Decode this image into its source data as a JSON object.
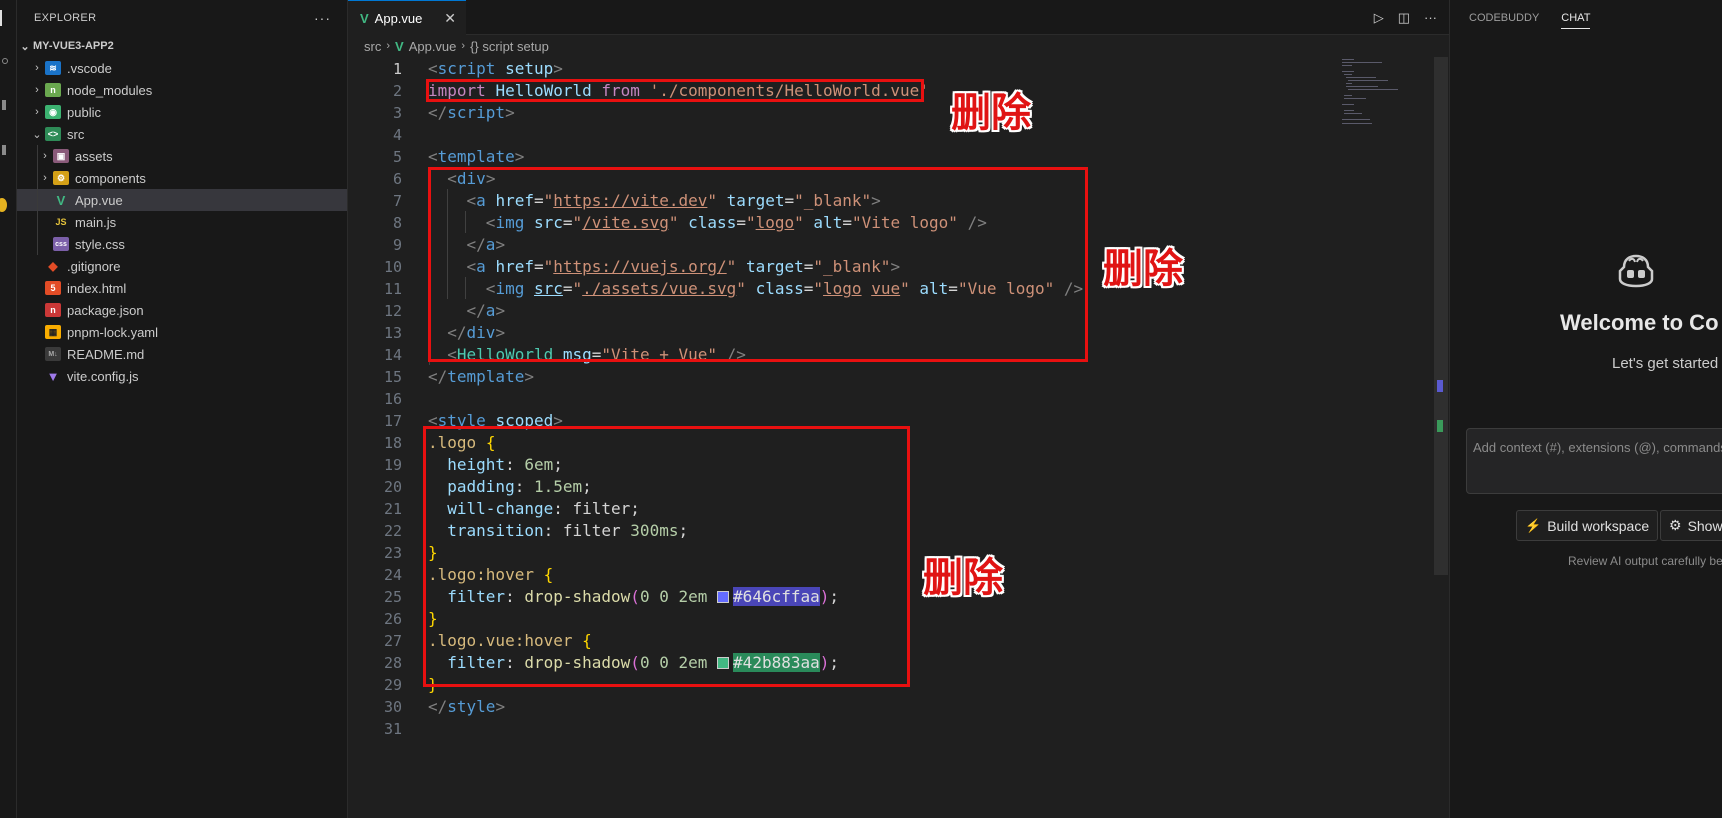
{
  "sidebar": {
    "title": "EXPLORER",
    "more": "···",
    "root": "MY-VUE3-APP2",
    "items": [
      {
        "label": ".vscode",
        "icon": "vscode-folder-icon"
      },
      {
        "label": "node_modules",
        "icon": "node-folder-icon"
      },
      {
        "label": "public",
        "icon": "public-folder-icon"
      },
      {
        "label": "src",
        "icon": "src-folder-icon"
      },
      {
        "label": "assets",
        "icon": "assets-folder-icon"
      },
      {
        "label": "components",
        "icon": "components-folder-icon"
      },
      {
        "label": "App.vue",
        "icon": "vue-file-icon"
      },
      {
        "label": "main.js",
        "icon": "js-file-icon",
        "badge": "JS"
      },
      {
        "label": "style.css",
        "icon": "css-file-icon",
        "badge": "css"
      },
      {
        "label": ".gitignore",
        "icon": "git-file-icon"
      },
      {
        "label": "index.html",
        "icon": "html-file-icon",
        "badge": "5"
      },
      {
        "label": "package.json",
        "icon": "npm-file-icon"
      },
      {
        "label": "pnpm-lock.yaml",
        "icon": "pnpm-file-icon"
      },
      {
        "label": "README.md",
        "icon": "markdown-file-icon",
        "badge": "M↓"
      },
      {
        "label": "vite.config.js",
        "icon": "vite-file-icon"
      }
    ]
  },
  "editor": {
    "tab": {
      "label": "App.vue",
      "close": "✕"
    },
    "breadcrumb": {
      "part1": "src",
      "part2": "App.vue",
      "part3": "{} script setup"
    },
    "line_numbers": [
      "1",
      "2",
      "3",
      "4",
      "5",
      "6",
      "7",
      "8",
      "9",
      "10",
      "11",
      "12",
      "13",
      "14",
      "15",
      "16",
      "17",
      "18",
      "19",
      "20",
      "21",
      "22",
      "23",
      "24",
      "25",
      "26",
      "27",
      "28",
      "29",
      "30",
      "31"
    ],
    "colors": {
      "swatch1": "#646cffaa",
      "swatch2": "#42b883aa"
    }
  },
  "annotations": {
    "delete_1": "删除",
    "delete_2": "删除",
    "delete_3": "删除"
  },
  "chat": {
    "tab_codebuddy": "CODEBUDDY",
    "tab_chat": "CHAT",
    "welcome": "Welcome to Co",
    "started": "Let's get started",
    "input_placeholder": "Add context (#), extensions (@), commands",
    "build_button": "Build workspace",
    "show_button": "Show",
    "review": "Review AI output carefully be"
  },
  "accent": {
    "selection": "#37373d",
    "tab_border": "#0078d4",
    "annotation_red": "#e81010"
  }
}
